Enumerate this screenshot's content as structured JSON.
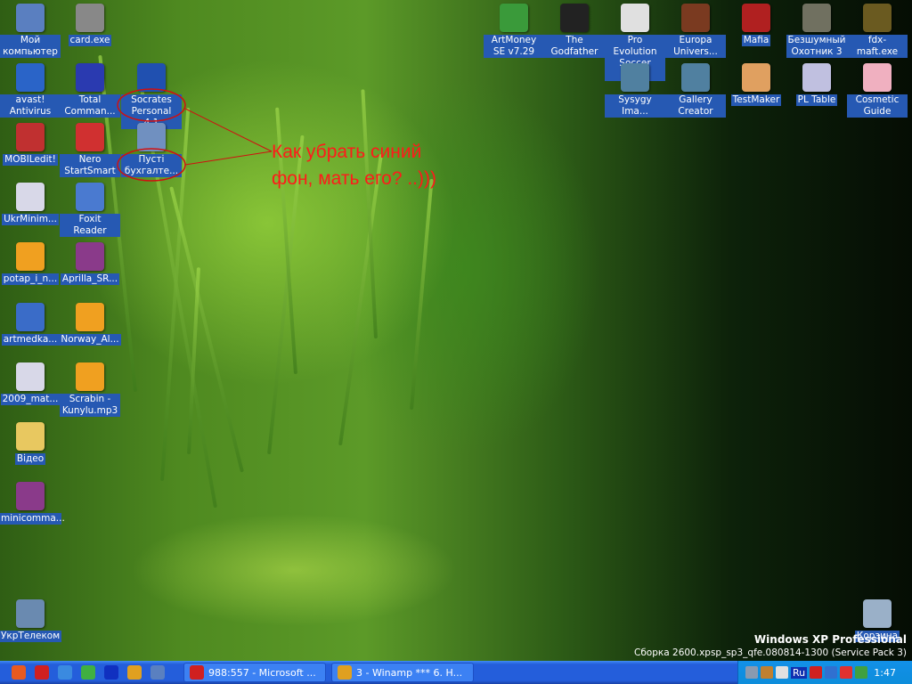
{
  "desktop_icons": [
    {
      "label": "Мой компьютер",
      "icon": "my-computer-icon",
      "color": "#5a7fc0"
    },
    {
      "label": "avast! Antivirus",
      "icon": "avast-icon",
      "color": "#2a64c8"
    },
    {
      "label": "MOBILedit!",
      "icon": "mobiledit-icon",
      "color": "#c03030"
    },
    {
      "label": "UkrMinim...",
      "icon": "pdf-icon",
      "color": "#d8d8e8"
    },
    {
      "label": "potap_i_n...",
      "icon": "winamp-file-icon",
      "color": "#f0a020"
    },
    {
      "label": "artmedka...",
      "icon": "word-doc-icon",
      "color": "#3a6cc8"
    },
    {
      "label": "2009_mat...",
      "icon": "pdf-icon",
      "color": "#d8d8e8"
    },
    {
      "label": "Відео",
      "icon": "folder-icon",
      "color": "#e8c860"
    },
    {
      "label": "minicomma...",
      "icon": "winrar-icon",
      "color": "#8a3a8a"
    },
    {
      "label": "УкрТелеком",
      "icon": "network-connection-icon",
      "color": "#6a8ab0"
    },
    {
      "label": "card.exe",
      "icon": "swf-icon",
      "color": "#888"
    },
    {
      "label": "Total Comman...",
      "icon": "total-commander-icon",
      "color": "#2a3ab0"
    },
    {
      "label": "Nero StartSmart",
      "icon": "nero-icon",
      "color": "#d03030"
    },
    {
      "label": "Foxit Reader",
      "icon": "foxit-icon",
      "color": "#4a7ad0"
    },
    {
      "label": "Aprilla_SR...",
      "icon": "winrar-icon",
      "color": "#8a3a8a"
    },
    {
      "label": "Norway_Al...",
      "icon": "winamp-file-icon",
      "color": "#f0a020"
    },
    {
      "label": "Scrabin - Kunylu.mp3",
      "icon": "winamp-file-icon",
      "color": "#f0a020"
    },
    {
      "label": "Socrates Personal 4.1",
      "icon": "socrates-icon",
      "color": "#2050b0"
    },
    {
      "label": "Пусті бухгалте...",
      "icon": "shortcut-icon",
      "color": "#7090c0"
    },
    {
      "label": "ArtMoney SE v7.29",
      "icon": "artmoney-icon",
      "color": "#3a9a3a"
    },
    {
      "label": "The Godfather",
      "icon": "godfather-icon",
      "color": "#222"
    },
    {
      "label": "Pro Evolution Soccer 2008",
      "icon": "pes-icon",
      "color": "#e0e0e0"
    },
    {
      "label": "Europa Univers...",
      "icon": "europa-icon",
      "color": "#7a3a20"
    },
    {
      "label": "Mafia",
      "icon": "mafia-icon",
      "color": "#b02020"
    },
    {
      "label": "Безшумный Охотник 3",
      "icon": "game-icon",
      "color": "#707060"
    },
    {
      "label": "fdx-maft.exe",
      "icon": "exe-icon",
      "color": "#6a5a20"
    },
    {
      "label": "Sysygy Ima...",
      "icon": "shortcut-icon",
      "color": "#5080a0"
    },
    {
      "label": "Gallery Creator",
      "icon": "shortcut-icon",
      "color": "#5080a0"
    },
    {
      "label": "TestMaker",
      "icon": "user-icon",
      "color": "#e0a060"
    },
    {
      "label": "PL Table",
      "icon": "table-icon",
      "color": "#c0c0e0"
    },
    {
      "label": "Cosmetic Guide",
      "icon": "cosmetic-icon",
      "color": "#f0b0c0"
    },
    {
      "label": "Корзина",
      "icon": "recycle-bin-icon",
      "color": "#9ab0c8"
    }
  ],
  "annotation": {
    "line1": "Как убрать синий",
    "line2": "фон, мать его? ..)))"
  },
  "watermark": {
    "line1": "Windows XP Professional",
    "line2": "Сборка 2600.xpsp_sp3_qfe.080814-1300 (Service Pack 3)"
  },
  "taskbar": {
    "quick_launch": [
      {
        "icon": "windows-start-icon",
        "color": "#e85a20"
      },
      {
        "icon": "opera-icon",
        "color": "#d02020"
      },
      {
        "icon": "internet-explorer-icon",
        "color": "#3a8ae0"
      },
      {
        "icon": "icq-icon",
        "color": "#40b040"
      },
      {
        "icon": "bluetooth-icon",
        "color": "#1030c0"
      },
      {
        "icon": "winamp-icon",
        "color": "#e0a020"
      },
      {
        "icon": "show-desktop-icon",
        "color": "#5a80c0"
      }
    ],
    "tasks": [
      {
        "label": "988:557 - Microsoft ...",
        "icon": "opera-icon",
        "color": "#d02020"
      },
      {
        "label": "3 - Winamp *** 6. H...",
        "icon": "winamp-icon",
        "color": "#e0a020"
      }
    ],
    "tray": [
      {
        "icon": "network-icon",
        "color": "#8a9ab0"
      },
      {
        "icon": "volume-icon",
        "color": "#c08030"
      },
      {
        "icon": "cow-icon",
        "color": "#e0e0e0"
      },
      {
        "icon": "updown-arrow-icon",
        "color": "#d02020"
      },
      {
        "icon": "avast-tray-icon",
        "color": "#3070d0"
      },
      {
        "icon": "antivirus-tray-icon",
        "color": "#e03030"
      },
      {
        "icon": "safe-remove-icon",
        "color": "#40a040"
      }
    ],
    "language": "Ru",
    "clock": "1:47"
  }
}
